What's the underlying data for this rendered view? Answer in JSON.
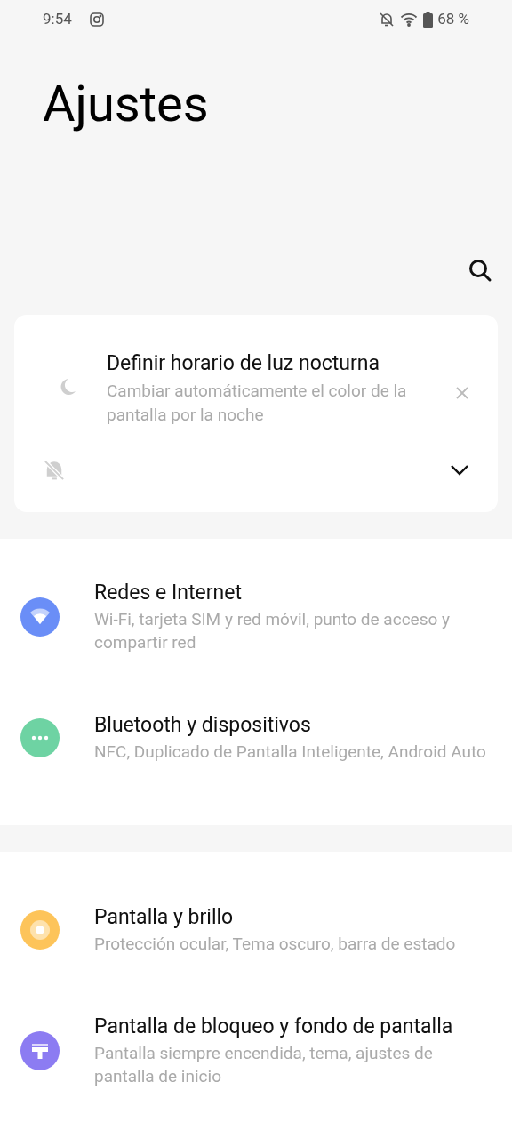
{
  "status_bar": {
    "time": "9:54",
    "battery": "68 %"
  },
  "header": {
    "title": "Ajustes"
  },
  "suggestion": {
    "title": "Definir horario de luz nocturna",
    "subtitle": "Cambiar automáticamente el color de la pantalla por la noche"
  },
  "groups": [
    {
      "items": [
        {
          "kind": "wifi",
          "color": "#6a8ef7",
          "title": "Redes e Internet",
          "subtitle": "Wi-Fi, tarjeta SIM y red móvil, punto de acceso y compartir red"
        },
        {
          "kind": "dots",
          "color": "#6ed3a3",
          "title": "Bluetooth y dispositivos",
          "subtitle": "NFC, Duplicado de Pantalla Inteligente, Android Auto"
        }
      ]
    },
    {
      "items": [
        {
          "kind": "brightness",
          "color": "#fdc45a",
          "title": "Pantalla y brillo",
          "subtitle": "Protección ocular, Tema oscuro, barra de estado"
        },
        {
          "kind": "brush",
          "color": "#8c7cf2",
          "title": "Pantalla de bloqueo y fondo de pantalla",
          "subtitle": "Pantalla siempre encendida, tema, ajustes de pantalla de inicio"
        }
      ]
    }
  ]
}
